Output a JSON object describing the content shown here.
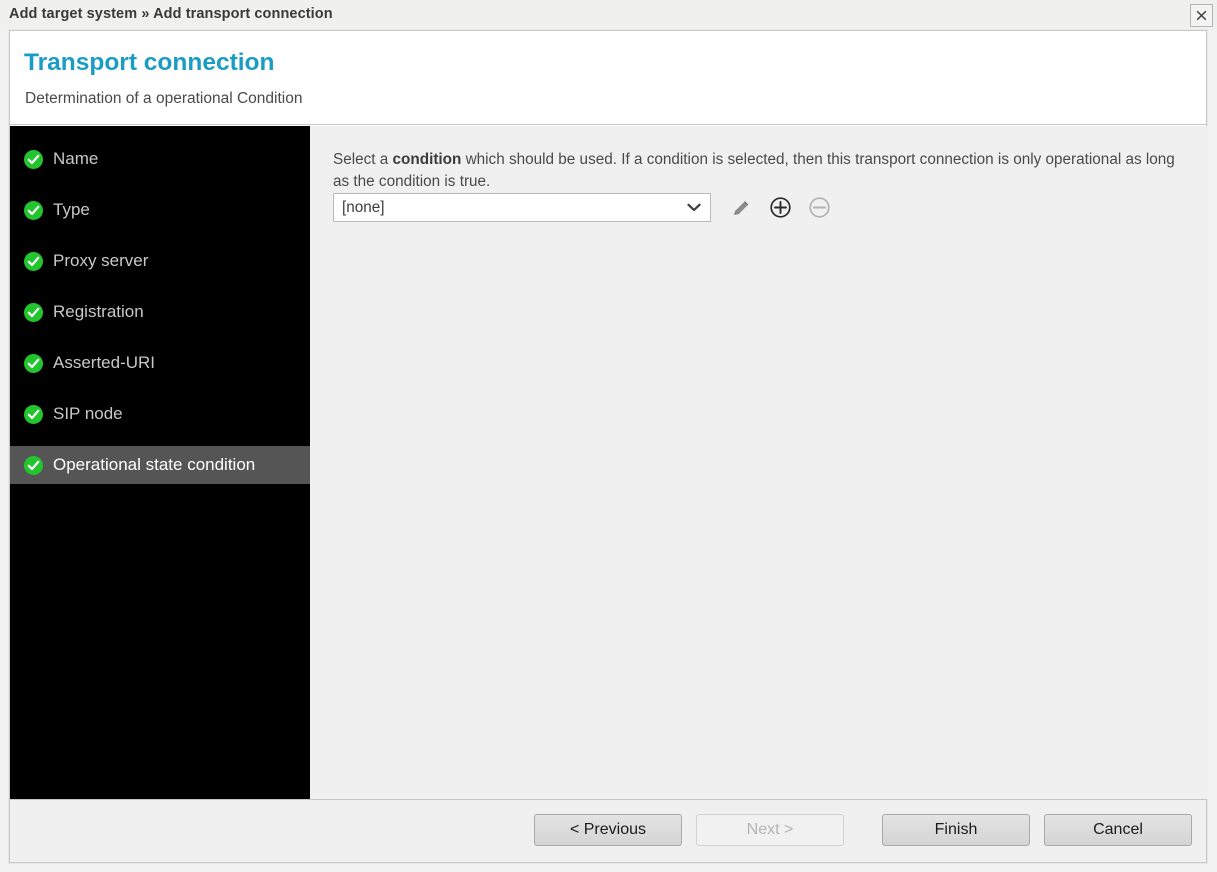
{
  "window": {
    "title": "Add target system » Add transport connection",
    "close_icon": "close-icon"
  },
  "header": {
    "title": "Transport connection",
    "subtitle": "Determination of a operational Condition",
    "accent_color": "#1a9dc4"
  },
  "sidebar": {
    "background_color": "#000000",
    "active_background_color": "#555555",
    "check_color": "#22c52e",
    "items": [
      {
        "label": "Name",
        "icon": "check-circle-icon",
        "completed": true,
        "active": false
      },
      {
        "label": "Type",
        "icon": "check-circle-icon",
        "completed": true,
        "active": false
      },
      {
        "label": "Proxy server",
        "icon": "check-circle-icon",
        "completed": true,
        "active": false
      },
      {
        "label": "Registration",
        "icon": "check-circle-icon",
        "completed": true,
        "active": false
      },
      {
        "label": "Asserted-URI",
        "icon": "check-circle-icon",
        "completed": true,
        "active": false
      },
      {
        "label": "SIP node",
        "icon": "check-circle-icon",
        "completed": true,
        "active": false
      },
      {
        "label": "Operational state condition",
        "icon": "check-circle-icon",
        "completed": true,
        "active": true
      }
    ]
  },
  "content": {
    "description_part1": "Select a ",
    "description_bold": "condition",
    "description_part2": " which should be used. If a condition is selected, then this transport connection is only operational as long as the condition is true.",
    "condition_select": {
      "value": "[none]",
      "options": [
        "[none]"
      ],
      "arrow_icon": "chevron-down-icon"
    },
    "tools": [
      {
        "name": "edit-pencil-icon",
        "label": "Edit",
        "enabled": false
      },
      {
        "name": "add-circle-icon",
        "label": "Add",
        "enabled": true
      },
      {
        "name": "remove-circle-icon",
        "label": "Remove",
        "enabled": false
      }
    ]
  },
  "footer": {
    "buttons": [
      {
        "label": "< Previous",
        "enabled": true
      },
      {
        "label": "Next >",
        "enabled": false
      },
      {
        "label": "Finish",
        "enabled": true
      },
      {
        "label": "Cancel",
        "enabled": true
      }
    ]
  }
}
